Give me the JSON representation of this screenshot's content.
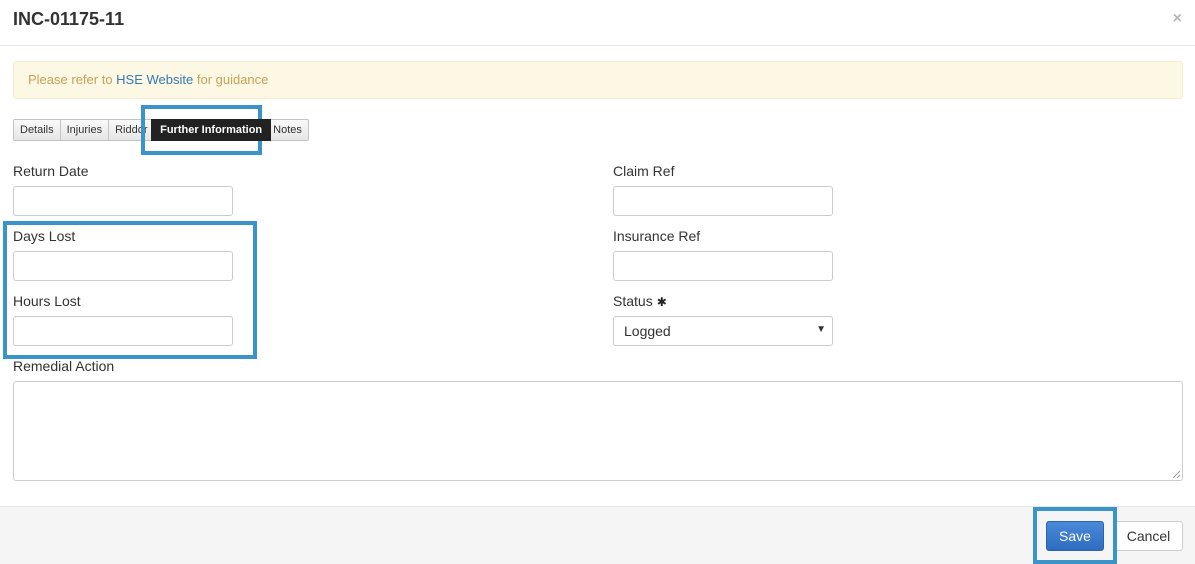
{
  "modal": {
    "title": "INC-01175-11",
    "close_glyph": "×"
  },
  "alert": {
    "prefix": "Please refer to ",
    "link": "HSE Website",
    "suffix": " for guidance"
  },
  "tabs": [
    {
      "label": "Details"
    },
    {
      "label": "Injuries"
    },
    {
      "label": "Riddor"
    },
    {
      "label": "Further Information",
      "active": true
    },
    {
      "label": "Notes"
    }
  ],
  "form": {
    "return_date": {
      "label": "Return Date",
      "value": ""
    },
    "days_lost": {
      "label": "Days Lost",
      "value": ""
    },
    "hours_lost": {
      "label": "Hours Lost",
      "value": ""
    },
    "claim_ref": {
      "label": "Claim Ref",
      "value": ""
    },
    "insurance_ref": {
      "label": "Insurance Ref",
      "value": ""
    },
    "status": {
      "label": "Status",
      "value": "Logged",
      "required_glyph": "✱"
    },
    "remedial_action": {
      "label": "Remedial Action",
      "value": ""
    }
  },
  "footer": {
    "save_label": "Save",
    "cancel_label": "Cancel"
  },
  "colors": {
    "highlight": "#3a93c9",
    "primary": "#2f6cc1",
    "alert_bg": "#fcf8e3"
  }
}
